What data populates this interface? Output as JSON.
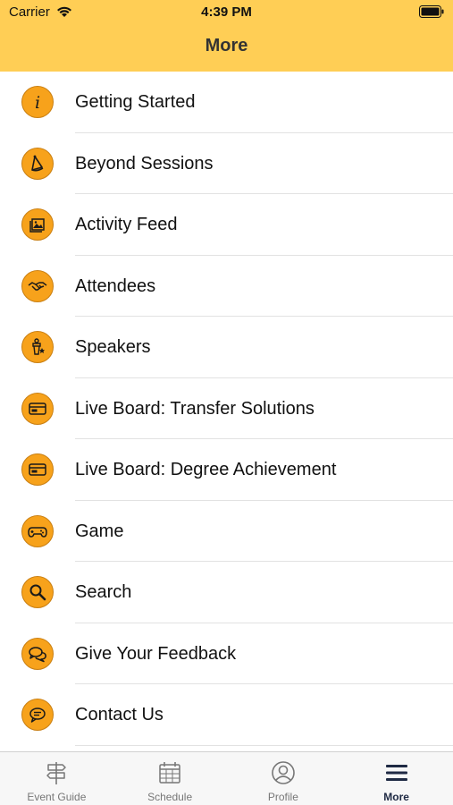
{
  "status_bar": {
    "carrier": "Carrier",
    "time": "4:39 PM"
  },
  "nav": {
    "title": "More"
  },
  "colors": {
    "header_bg": "#FFCE55",
    "icon_bg": "#F7A21B",
    "tab_active": "#1F2A44"
  },
  "menu": {
    "items": [
      {
        "label": "Getting Started",
        "icon": "info-icon"
      },
      {
        "label": "Beyond Sessions",
        "icon": "party-hat-icon"
      },
      {
        "label": "Activity Feed",
        "icon": "photo-gallery-icon"
      },
      {
        "label": "Attendees",
        "icon": "handshake-icon"
      },
      {
        "label": "Speakers",
        "icon": "speaker-podium-icon"
      },
      {
        "label": "Live Board: Transfer Solutions",
        "icon": "board-icon"
      },
      {
        "label": "Live Board: Degree Achievement",
        "icon": "board-icon"
      },
      {
        "label": "Game",
        "icon": "gamepad-icon"
      },
      {
        "label": "Search",
        "icon": "search-icon"
      },
      {
        "label": "Give Your Feedback",
        "icon": "chat-bubbles-icon"
      },
      {
        "label": "Contact Us",
        "icon": "speech-bubble-icon"
      }
    ]
  },
  "tabs": [
    {
      "label": "Event Guide",
      "icon": "signpost-icon",
      "active": false
    },
    {
      "label": "Schedule",
      "icon": "calendar-icon",
      "active": false
    },
    {
      "label": "Profile",
      "icon": "profile-icon",
      "active": false
    },
    {
      "label": "More",
      "icon": "hamburger-menu-icon",
      "active": true
    }
  ]
}
